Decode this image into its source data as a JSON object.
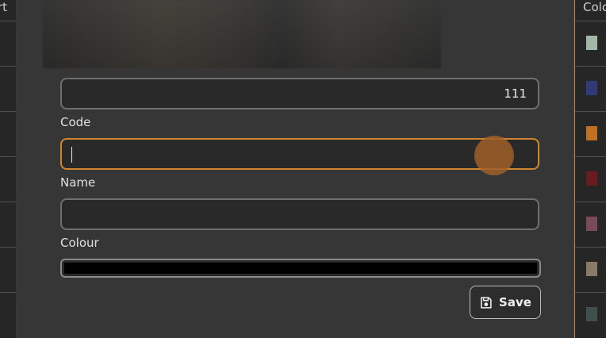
{
  "background_table": {
    "left_header": "rt",
    "right_header": "Colo",
    "swatches": [
      "#9fb9a6",
      "#2d3b78",
      "#c07020",
      "#6b1a1f",
      "#7a4a58",
      "#8a7a68",
      "#3f4f4c"
    ]
  },
  "form": {
    "code": {
      "value": "111",
      "label": "Code"
    },
    "name": {
      "value": "",
      "label": "Name"
    },
    "colour": {
      "value": "",
      "label": "Colour",
      "swatch_color": "#000000"
    },
    "save_label": "Save",
    "save_icon": "floppy-disk-icon"
  },
  "accent_color": "#d0862c"
}
